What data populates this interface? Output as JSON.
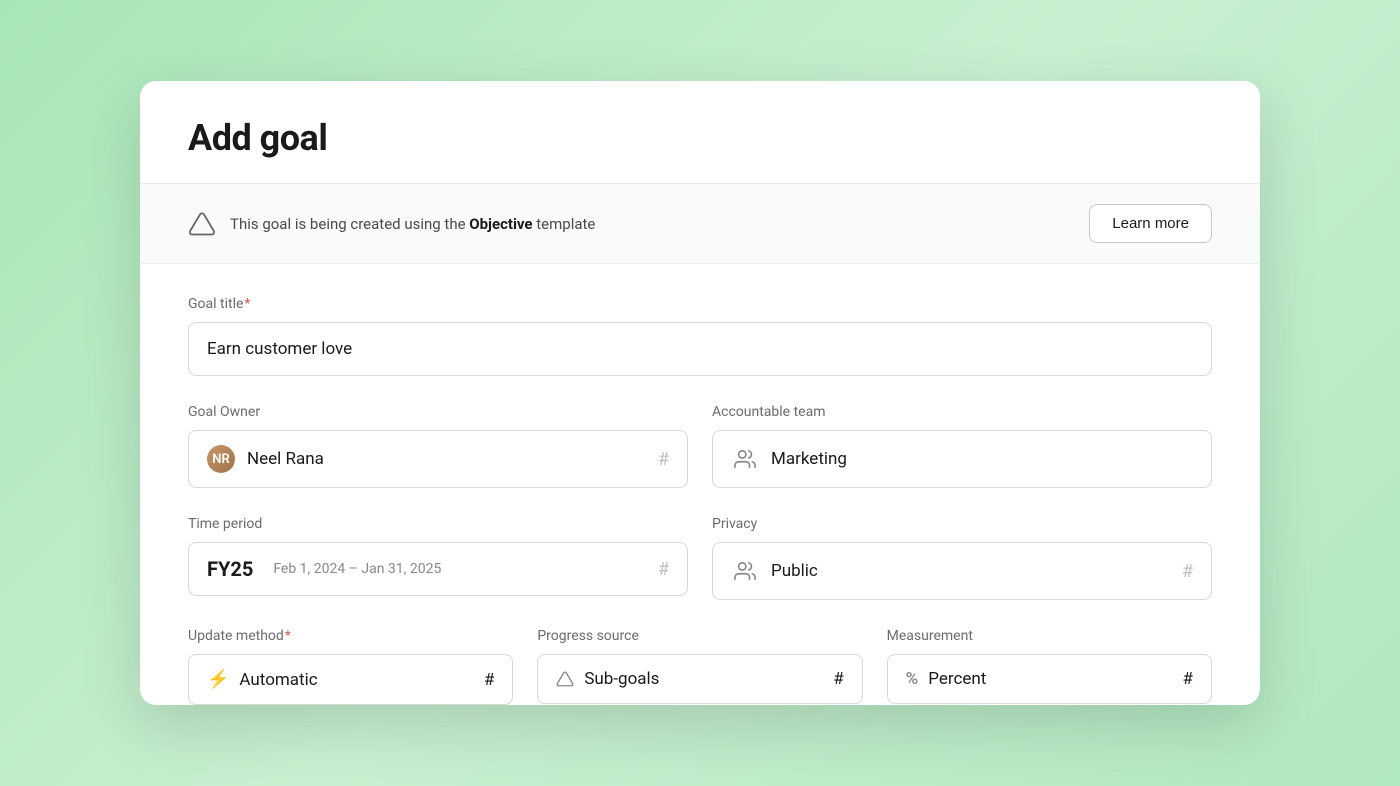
{
  "modal": {
    "title": "Add goal",
    "template_banner": {
      "text_before": "This goal is being created using the ",
      "template_name": "Objective",
      "text_after": " template",
      "learn_more_label": "Learn more"
    },
    "form": {
      "goal_title_label": "Goal title",
      "goal_title_required": "*",
      "goal_title_value": "Earn customer love",
      "goal_owner_label": "Goal Owner",
      "goal_owner_value": "Neel Rana",
      "goal_owner_hash": "#",
      "accountable_team_label": "Accountable team",
      "accountable_team_value": "Marketing",
      "time_period_label": "Time period",
      "time_period_value": "FY25",
      "time_period_subtext": "Feb 1, 2024 – Jan 31, 2025",
      "time_period_hash": "#",
      "privacy_label": "Privacy",
      "privacy_value": "Public",
      "privacy_hash": "#",
      "update_method_label": "Update method",
      "update_method_required": "*",
      "update_method_value": "Automatic",
      "update_method_hash": "#",
      "progress_source_label": "Progress source",
      "progress_source_value": "Sub-goals",
      "progress_source_hash": "#",
      "measurement_label": "Measurement",
      "measurement_value": "Percent",
      "measurement_hash": "#"
    }
  }
}
